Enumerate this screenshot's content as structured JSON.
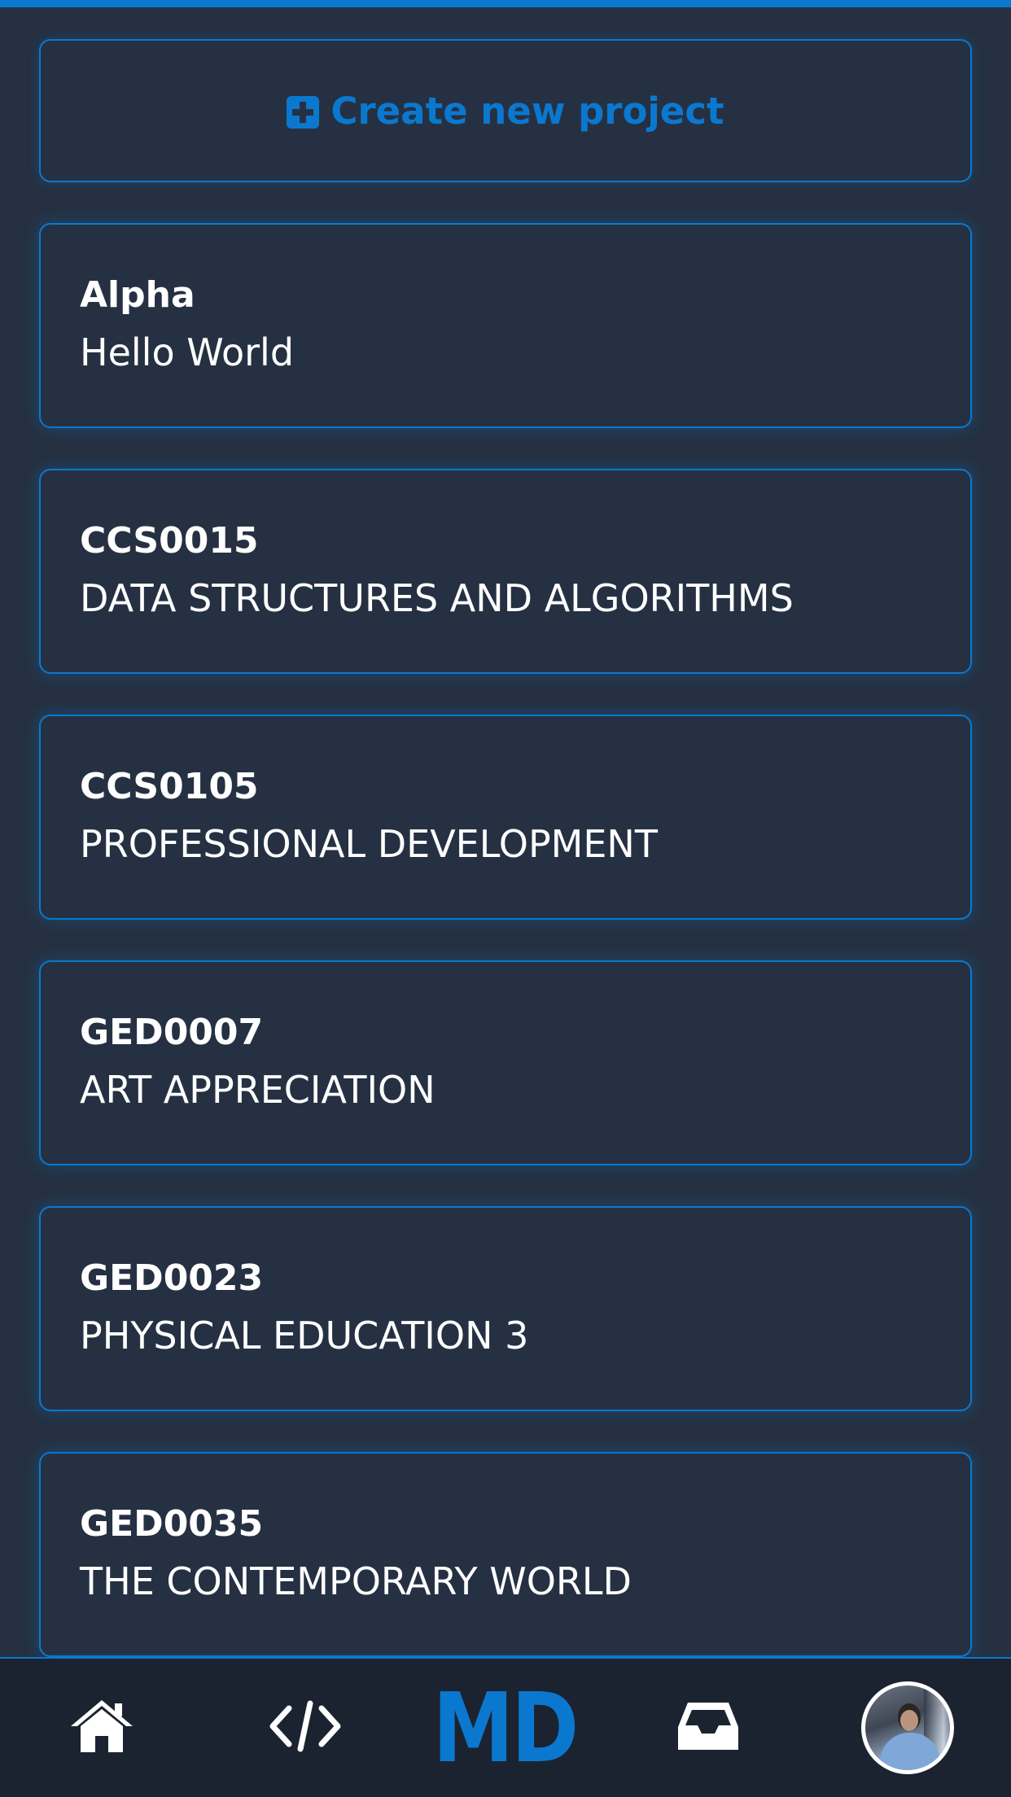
{
  "header": {
    "create_label": "Create new project",
    "create_icon": "plus-square-icon"
  },
  "projects": [
    {
      "code": "Alpha",
      "name": "Hello World"
    },
    {
      "code": "CCS0015",
      "name": "DATA STRUCTURES AND ALGORITHMS"
    },
    {
      "code": "CCS0105",
      "name": "PROFESSIONAL DEVELOPMENT"
    },
    {
      "code": "GED0007",
      "name": "ART APPRECIATION"
    },
    {
      "code": "GED0023",
      "name": "PHYSICAL EDUCATION 3"
    },
    {
      "code": "GED0035",
      "name": "THE CONTEMPORARY WORLD"
    }
  ],
  "nav": {
    "items": [
      {
        "icon": "home-icon"
      },
      {
        "icon": "code-icon"
      },
      {
        "logo_text": "MD"
      },
      {
        "icon": "inbox-icon"
      },
      {
        "icon": "avatar"
      }
    ]
  },
  "colors": {
    "accent": "#0b78d0",
    "background": "#253142",
    "nav_background": "#1c2330",
    "text": "#ffffff"
  }
}
